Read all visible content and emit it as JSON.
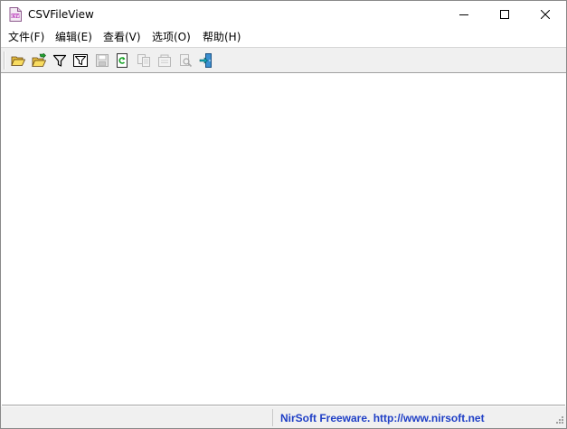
{
  "window": {
    "title": "CSVFileView",
    "app_icon": "csv-file-icon"
  },
  "caption_buttons": {
    "minimize": "minimize-icon",
    "maximize": "maximize-icon",
    "close": "close-icon"
  },
  "menu": {
    "items": [
      {
        "label": "文件(F)"
      },
      {
        "label": "编辑(E)"
      },
      {
        "label": "查看(V)"
      },
      {
        "label": "选项(O)"
      },
      {
        "label": "帮助(H)"
      }
    ]
  },
  "toolbar": {
    "buttons": [
      {
        "icon": "open-folder-icon",
        "enabled": true
      },
      {
        "icon": "open-folder-green-icon",
        "enabled": true
      },
      {
        "icon": "filter-icon",
        "enabled": true
      },
      {
        "icon": "filter-box-icon",
        "enabled": true
      },
      {
        "icon": "save-icon",
        "enabled": false
      },
      {
        "icon": "refresh-icon",
        "enabled": true
      },
      {
        "icon": "copy-icon",
        "enabled": false
      },
      {
        "icon": "properties-icon",
        "enabled": false
      },
      {
        "icon": "find-icon",
        "enabled": false
      },
      {
        "icon": "exit-icon",
        "enabled": true
      }
    ]
  },
  "statusbar": {
    "link_text": "NirSoft Freeware.  http://www.nirsoft.net",
    "link_color": "#1f3fc6"
  }
}
